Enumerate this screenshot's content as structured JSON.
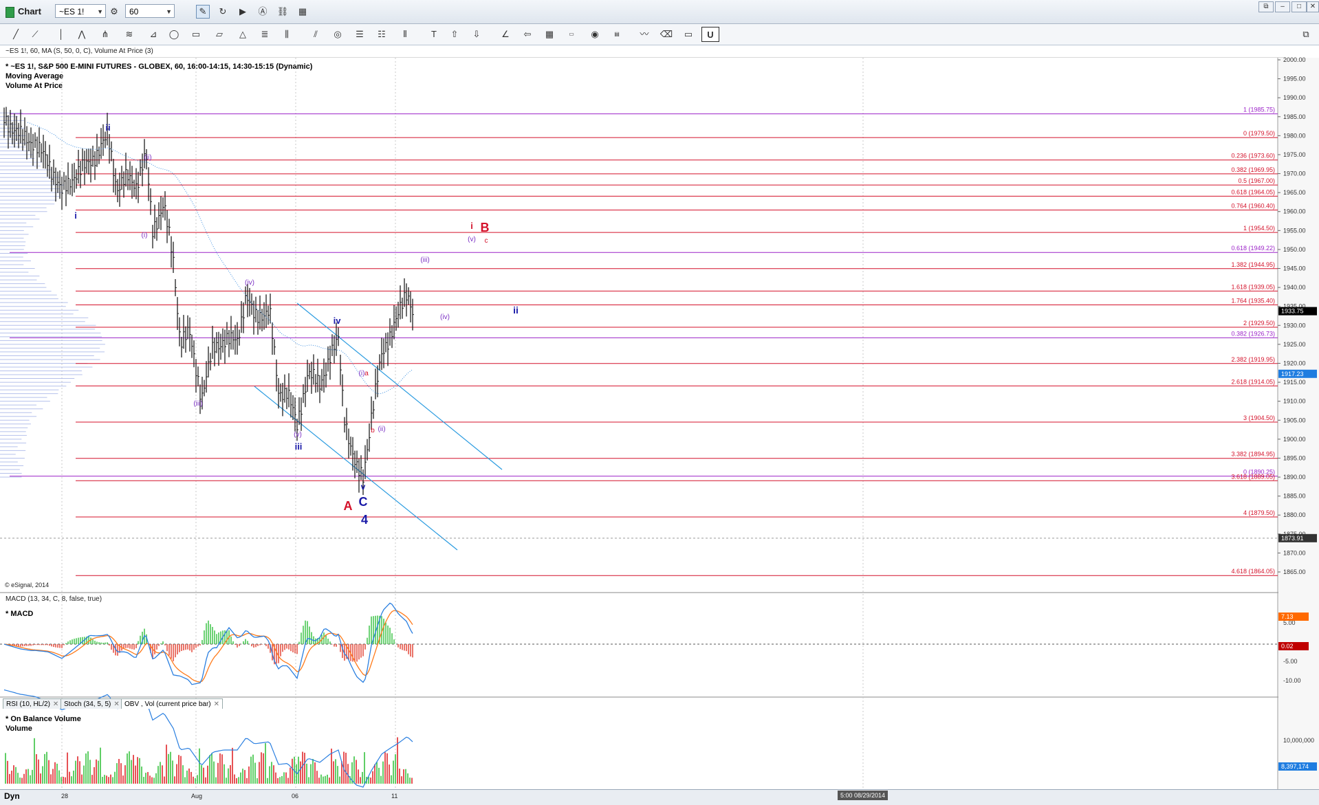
{
  "window": {
    "title": "Chart",
    "symbol": "~ES 1!",
    "interval": "60"
  },
  "header": "~ES 1!, 60, MA (S, 50, 0, C), Volume At Price (3)",
  "studies_title": "* ~ES 1!, S&P 500 E-MINI FUTURES - GLOBEX, 60, 16:00-14:15, 14:30-15:15 (Dynamic)",
  "studies": [
    "Moving Average",
    "Volume At Price"
  ],
  "copyright": "© eSignal, 2014",
  "macd": {
    "header": "MACD (13, 34, C, 8, false, true)",
    "name": "* MACD",
    "badges": [
      {
        "text": "7.13",
        "color": "#ff6a00"
      },
      {
        "text": "0.02",
        "color": "#c00000"
      }
    ]
  },
  "tabs": [
    "RSI (10, HL/2)",
    "Stoch (34, 5, 5)",
    "OBV , Vol (current price bar)"
  ],
  "obv": {
    "name": "* On Balance Volume",
    "sub": "Volume",
    "badge": {
      "text": "8,397,174",
      "color": "#1f7de0"
    }
  },
  "bottom": {
    "dyn": "Dyn",
    "dateflag": "5:00 08/29/2014"
  },
  "chart_data": {
    "type": "ohlc",
    "symbol": "~ES 1!",
    "price_axis_ticks": [
      2000,
      1995,
      1990,
      1985,
      1980,
      1975,
      1970,
      1965,
      1960,
      1955,
      1950,
      1945,
      1940,
      1935,
      1930,
      1925,
      1920,
      1915,
      1910,
      1905,
      1900,
      1895,
      1890,
      1885,
      1880,
      1875,
      1870,
      1865
    ],
    "price_ylim": [
      1863,
      2000
    ],
    "last_price": "1933.75",
    "price_badges": [
      {
        "price": 1933.75,
        "text": "1933.75",
        "color": "#000000"
      },
      {
        "price": 1917.23,
        "text": "1917.23",
        "color": "#1f7de0"
      },
      {
        "price": 1873.91,
        "text": "1873.91",
        "color": "#333333"
      }
    ],
    "x_tick_labels": [
      "28",
      "Aug",
      "06",
      "11"
    ],
    "fib_levels": [
      {
        "ratio": "1",
        "price": 1985.75,
        "label": "1 (1985.75)",
        "color": "#9b22c8"
      },
      {
        "ratio": "0",
        "price": 1979.5,
        "label": "0 (1979.50)",
        "color": "#d4112a"
      },
      {
        "ratio": "0.236",
        "price": 1973.6,
        "label": "0.236 (1973.60)",
        "color": "#d4112a"
      },
      {
        "ratio": "0.382",
        "price": 1969.95,
        "label": "0.382 (1969.95)",
        "color": "#d4112a"
      },
      {
        "ratio": "0.5",
        "price": 1967.0,
        "label": "0.5 (1967.00)",
        "color": "#d4112a"
      },
      {
        "ratio": "0.618",
        "price": 1964.05,
        "label": "0.618 (1964.05)",
        "color": "#d4112a"
      },
      {
        "ratio": "0.764",
        "price": 1960.4,
        "label": "0.764 (1960.40)",
        "color": "#d4112a"
      },
      {
        "ratio": "1",
        "price": 1954.5,
        "label": "1 (1954.50)",
        "color": "#d4112a"
      },
      {
        "ratio": "0.618",
        "price": 1949.22,
        "label": "0.618 (1949.22)",
        "color": "#9b22c8"
      },
      {
        "ratio": "1.382",
        "price": 1944.95,
        "label": "1.382 (1944.95)",
        "color": "#d4112a"
      },
      {
        "ratio": "1.618",
        "price": 1939.05,
        "label": "1.618 (1939.05)",
        "color": "#d4112a"
      },
      {
        "ratio": "1.764",
        "price": 1935.4,
        "label": "1.764 (1935.40)",
        "color": "#d4112a"
      },
      {
        "ratio": "2",
        "price": 1929.5,
        "label": "2 (1929.50)",
        "color": "#d4112a"
      },
      {
        "ratio": "0.382",
        "price": 1926.73,
        "label": "0.382 (1926.73)",
        "color": "#9b22c8"
      },
      {
        "ratio": "2.382",
        "price": 1919.95,
        "label": "2.382 (1919.95)",
        "color": "#d4112a"
      },
      {
        "ratio": "2.618",
        "price": 1914.05,
        "label": "2.618 (1914.05)",
        "color": "#d4112a"
      },
      {
        "ratio": "3",
        "price": 1904.5,
        "label": "3 (1904.50)",
        "color": "#d4112a"
      },
      {
        "ratio": "3.382",
        "price": 1894.95,
        "label": "3.382 (1894.95)",
        "color": "#d4112a"
      },
      {
        "ratio": "0",
        "price": 1890.25,
        "label": "0 (1890.25)",
        "color": "#9b22c8"
      },
      {
        "ratio": "3.618",
        "price": 1889.05,
        "label": "3.618 (1889.05)",
        "color": "#d4112a"
      },
      {
        "ratio": "4",
        "price": 1879.5,
        "label": "4 (1879.50)",
        "color": "#d4112a"
      },
      {
        "ratio": "4.618",
        "price": 1864.05,
        "label": "4.618 (1864.05)",
        "color": "#d4112a"
      }
    ],
    "wave_labels": [
      {
        "text": "ii",
        "color": "#1a1aa8",
        "bold": true
      },
      {
        "text": "(ii)",
        "color": "#7b2fc4",
        "bold": false
      },
      {
        "text": "i",
        "color": "#1a1aa8",
        "bold": true
      },
      {
        "text": "(i)",
        "color": "#7b2fc4",
        "bold": false
      },
      {
        "text": "(iv)",
        "color": "#7b2fc4",
        "bold": false
      },
      {
        "text": "(iii)",
        "color": "#7b2fc4",
        "bold": false
      },
      {
        "text": "iv",
        "color": "#1a1aa8",
        "bold": true
      },
      {
        "text": "(v)",
        "color": "#7b2fc4",
        "bold": false
      },
      {
        "text": "iii",
        "color": "#1a1aa8",
        "bold": true
      },
      {
        "text": "(i)",
        "color": "#7b2fc4",
        "bold": false
      },
      {
        "text": "a",
        "color": "#d4112a",
        "bold": false
      },
      {
        "text": "b",
        "color": "#d4112a",
        "bold": false
      },
      {
        "text": "(ii)",
        "color": "#7b2fc4",
        "bold": false
      },
      {
        "text": "v",
        "color": "#1a1aa8",
        "bold": true
      },
      {
        "text": "A",
        "color": "#d4112a",
        "bold": true
      },
      {
        "text": "C",
        "color": "#1a1aa8",
        "bold": true
      },
      {
        "text": "4",
        "color": "#1a1aa8",
        "bold": true
      },
      {
        "text": "i",
        "color": "#d4112a",
        "bold": true
      },
      {
        "text": "(v)",
        "color": "#7b2fc4",
        "bold": false
      },
      {
        "text": "B",
        "color": "#d4112a",
        "bold": true
      },
      {
        "text": "c",
        "color": "#d4112a",
        "bold": false
      },
      {
        "text": "(iii)",
        "color": "#7b2fc4",
        "bold": false
      },
      {
        "text": "(iv)",
        "color": "#7b2fc4",
        "bold": false
      },
      {
        "text": "ii",
        "color": "#1a1aa8",
        "bold": true
      }
    ],
    "macd_axis_ticks": [
      5.0,
      -5.0,
      -10.0
    ],
    "obv_axis_ticks": [
      "10,000,000"
    ]
  }
}
